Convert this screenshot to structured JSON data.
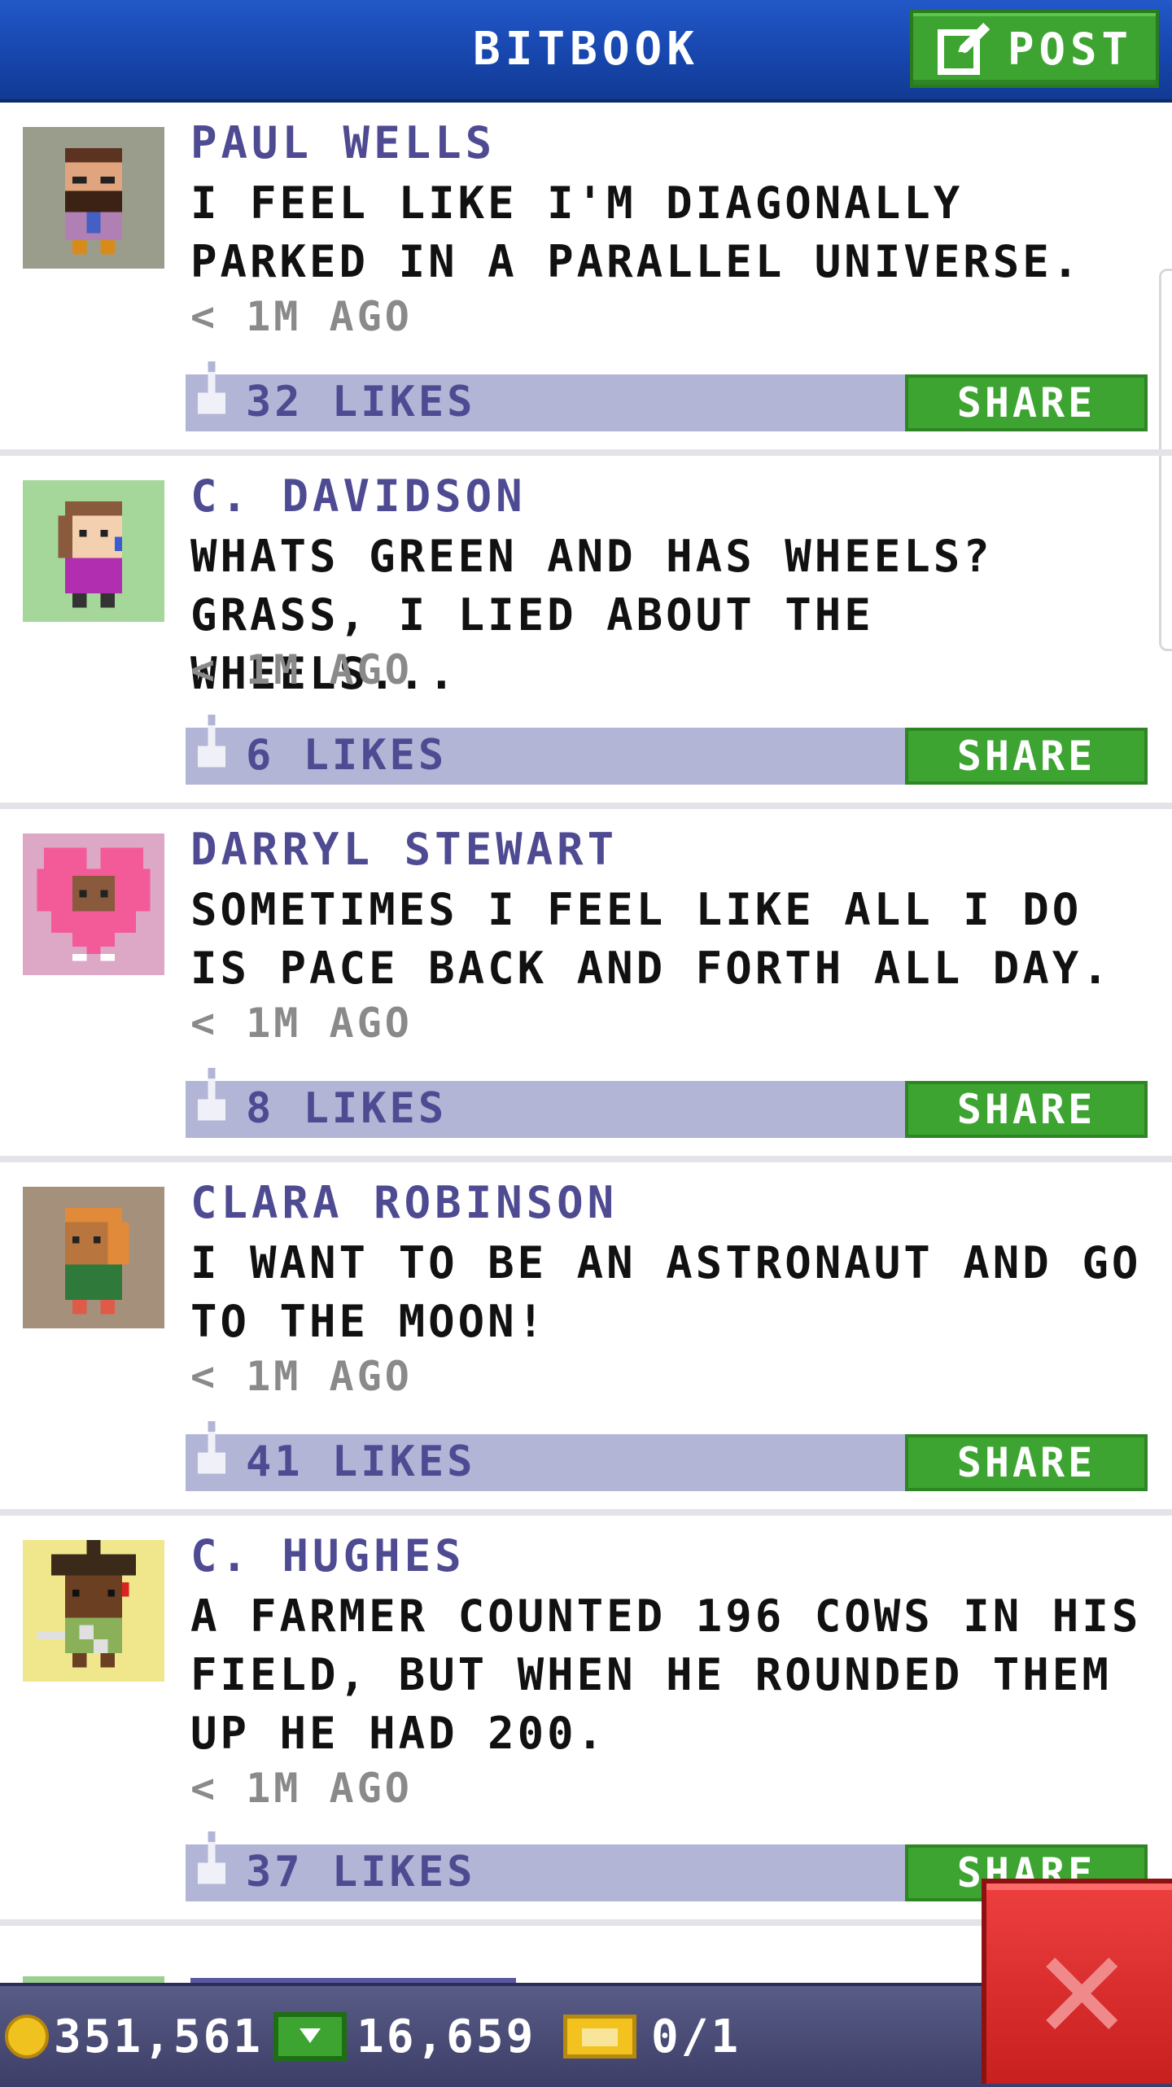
{
  "header": {
    "title": "BITBOOK",
    "post_label": "POST",
    "bg_color": "#1a4cb8",
    "button_color": "#3da431"
  },
  "posts": [
    {
      "author": "PAUL WELLS",
      "text": "I FEEL LIKE I'M DIAGONALLY PARKED IN A PARALLEL UNIVERSE.",
      "time": "< 1M AGO",
      "likes": "32 LIKES",
      "share": "SHARE",
      "avatar_bg": "#9a9d8c"
    },
    {
      "author": "C. DAVIDSON",
      "text": "WHATS GREEN AND HAS WHEELS? GRASS, I LIED ABOUT THE WHEELS...",
      "time": "< 1M AGO",
      "likes": "6 LIKES",
      "share": "SHARE",
      "avatar_bg": "#a5d69a"
    },
    {
      "author": "DARRYL STEWART",
      "text": "SOMETIMES I FEEL LIKE ALL I DO IS PACE BACK AND FORTH ALL DAY.",
      "time": "< 1M AGO",
      "likes": "8 LIKES",
      "share": "SHARE",
      "avatar_bg": "#dda8c6"
    },
    {
      "author": "CLARA ROBINSON",
      "text": "I WANT TO BE AN ASTRONAUT AND GO TO THE MOON!",
      "time": "< 1M AGO",
      "likes": "41 LIKES",
      "share": "SHARE",
      "avatar_bg": "#a5907b"
    },
    {
      "author": "C. HUGHES",
      "text": "A FARMER COUNTED 196 COWS IN HIS FIELD, BUT WHEN HE ROUNDED THEM UP HE HAD 200.",
      "time": "< 1M AGO",
      "likes": "37 LIKES",
      "share": "SHARE",
      "avatar_bg": "#f0e68c"
    }
  ],
  "bottom_bar": {
    "coins": "351,561",
    "bux": "16,659",
    "tickets": "0/1"
  },
  "icons": {
    "post": "edit-icon",
    "like": "thumbs-up-icon",
    "coin": "coin-icon",
    "bux": "bux-icon",
    "ticket": "ticket-icon",
    "close": "close-icon"
  },
  "colors": {
    "author": "#4f4b92",
    "like_bar": "#b3b5d7",
    "share": "#3da431",
    "close": "#d92a2a"
  }
}
